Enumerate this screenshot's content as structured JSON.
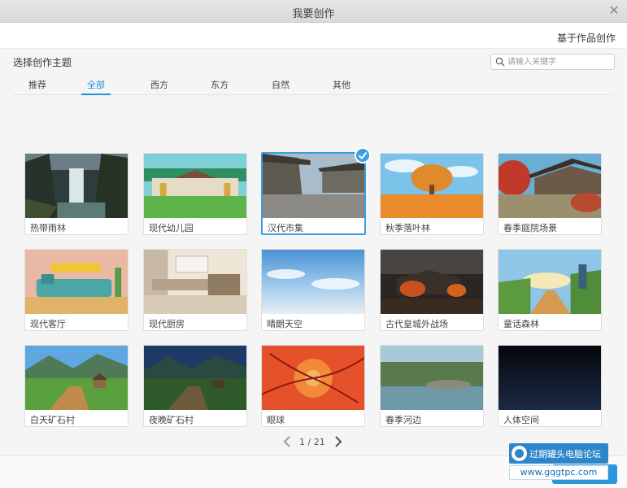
{
  "window": {
    "title": "我要创作",
    "close_icon": "close-icon"
  },
  "subbar": {
    "based_on_work": "基于作品创作"
  },
  "section": {
    "title": "选择创作主题"
  },
  "search": {
    "placeholder": "请输入关键字",
    "value": ""
  },
  "tabs": [
    {
      "label": "推荐",
      "active": false
    },
    {
      "label": "全部",
      "active": true
    },
    {
      "label": "西方",
      "active": false
    },
    {
      "label": "东方",
      "active": false
    },
    {
      "label": "自然",
      "active": false
    },
    {
      "label": "其他",
      "active": false
    }
  ],
  "themes": [
    {
      "label": "热带雨林",
      "selected": false
    },
    {
      "label": "现代幼儿园",
      "selected": false
    },
    {
      "label": "汉代市集",
      "selected": true
    },
    {
      "label": "秋季落叶林",
      "selected": false
    },
    {
      "label": "春季庭院场景",
      "selected": false
    },
    {
      "label": "现代客厅",
      "selected": false
    },
    {
      "label": "现代厨房",
      "selected": false
    },
    {
      "label": "晴朗天空",
      "selected": false
    },
    {
      "label": "古代皇城外战场",
      "selected": false
    },
    {
      "label": "童话森林",
      "selected": false
    },
    {
      "label": "白天矿石村",
      "selected": false
    },
    {
      "label": "夜晚矿石村",
      "selected": false
    },
    {
      "label": "眼球",
      "selected": false
    },
    {
      "label": "春季河边",
      "selected": false
    },
    {
      "label": "人体空间",
      "selected": false
    }
  ],
  "pager": {
    "info": "1 / 21"
  },
  "watermark": {
    "title": "过期罐头电脑论坛",
    "url": "www.gqgtpc.com"
  },
  "colors": {
    "accent": "#1f90d8",
    "selected_border": "#3a9ee2"
  }
}
